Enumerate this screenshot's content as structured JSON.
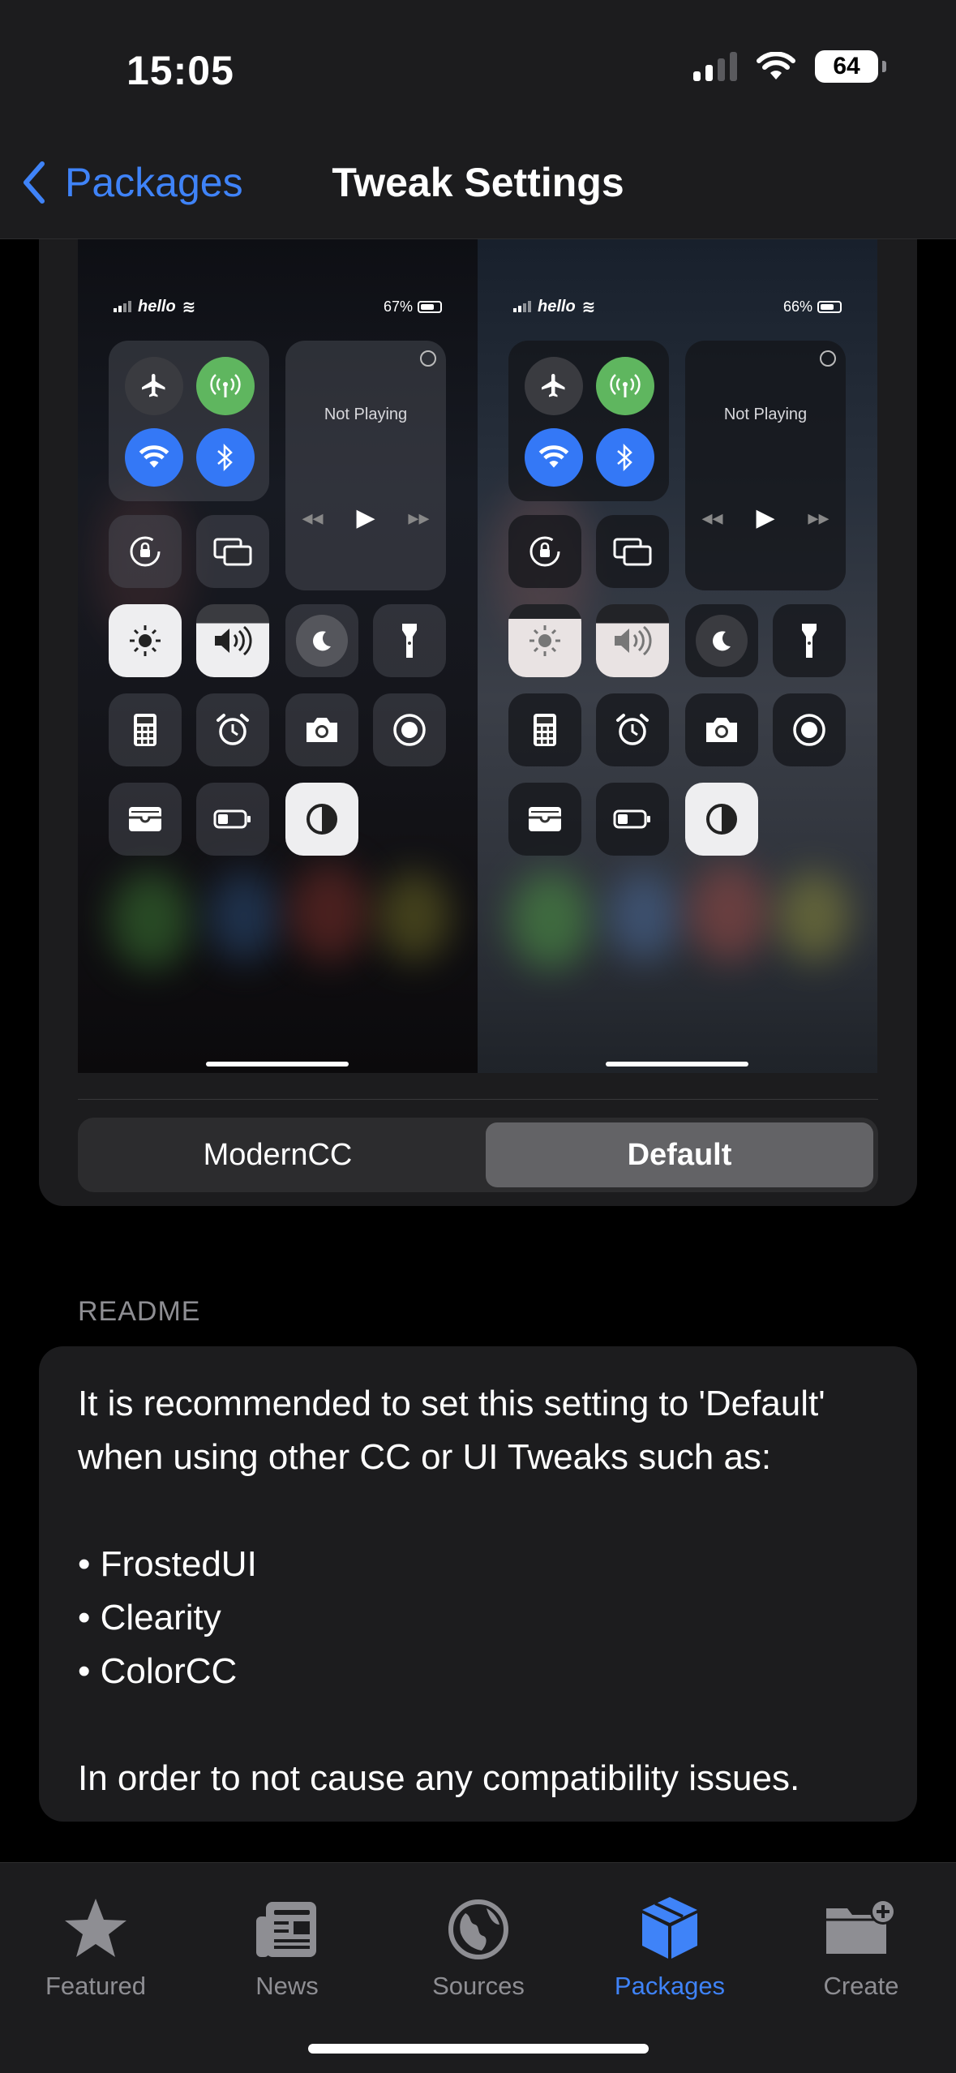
{
  "status_bar": {
    "time": "15:05",
    "battery": "64"
  },
  "nav": {
    "back_label": "Packages",
    "title": "Tweak Settings"
  },
  "preview": {
    "left": {
      "carrier": "hello",
      "battery_pct": "67%",
      "now_playing": "Not Playing"
    },
    "right": {
      "carrier": "hello",
      "battery_pct": "66%",
      "now_playing": "Not Playing"
    }
  },
  "segmented": {
    "options": [
      "ModernCC",
      "Default"
    ],
    "selected": "Default"
  },
  "readme": {
    "section_label": "README",
    "text": "It is recommended to set this setting to 'Default'\nwhen using other CC or UI Tweaks such as:\n\n• FrostedUI\n• Clearity\n• ColorCC\n\nIn order to not cause any compatibility issues."
  },
  "tabs": [
    {
      "label": "Featured",
      "icon": "star-icon"
    },
    {
      "label": "News",
      "icon": "newspaper-icon"
    },
    {
      "label": "Sources",
      "icon": "globe-icon"
    },
    {
      "label": "Packages",
      "icon": "box-icon"
    },
    {
      "label": "Create",
      "icon": "folder-plus-icon"
    }
  ],
  "active_tab": "Packages",
  "colors": {
    "accent": "#3f83f8",
    "green": "#5fb65f",
    "card": "#1c1c1e"
  }
}
